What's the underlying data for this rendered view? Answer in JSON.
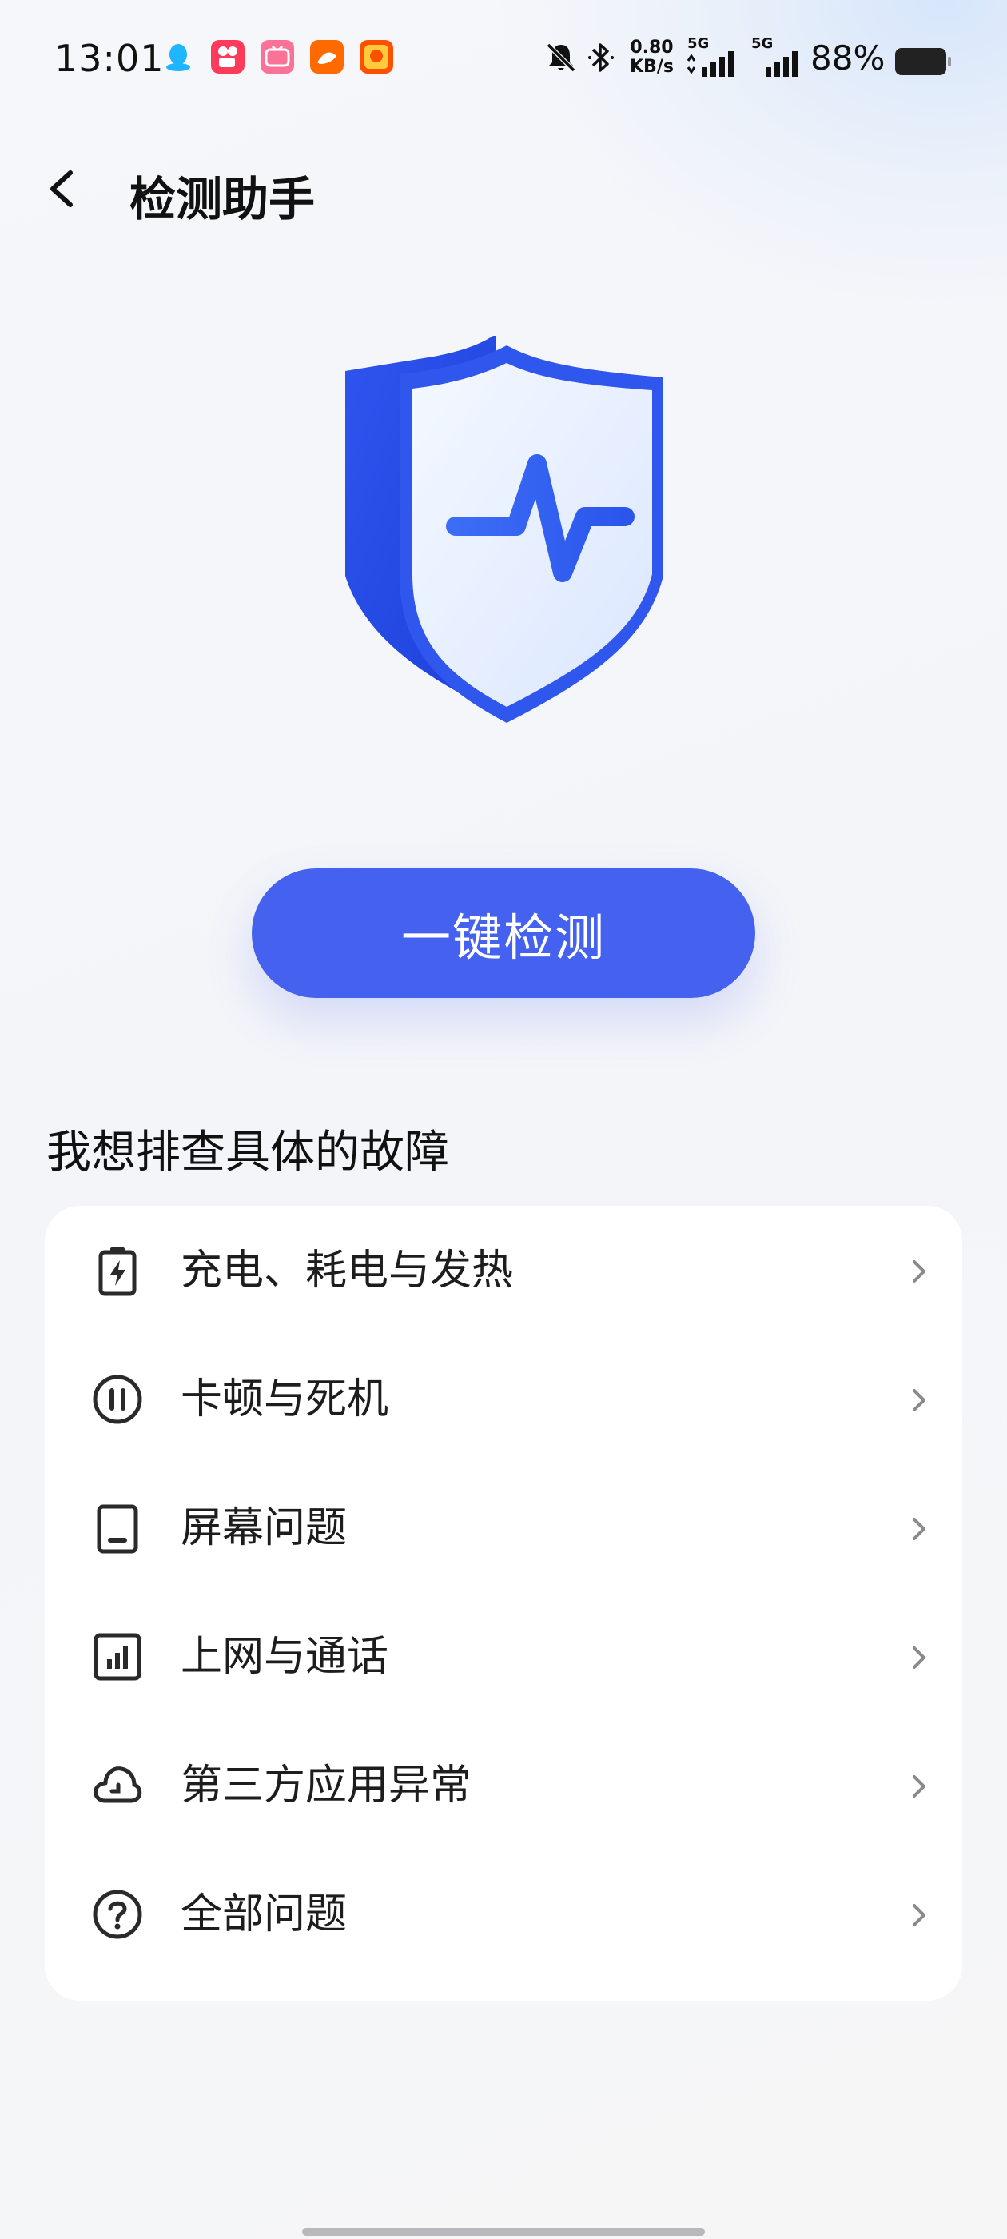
{
  "status_bar": {
    "time": "13:01",
    "net_speed_value": "0.80",
    "net_speed_unit": "KB/s",
    "signal1_label": "5G",
    "signal2_label": "5G",
    "battery": "88%"
  },
  "header": {
    "title": "检测助手",
    "back_icon": "chevron-left-icon"
  },
  "main": {
    "detect_button_label": "一键检测",
    "section_title": "我想排查具体的故障"
  },
  "issues": [
    {
      "label": "充电、耗电与发热",
      "icon": "battery-charge-icon"
    },
    {
      "label": "卡顿与死机",
      "icon": "pause-circle-icon"
    },
    {
      "label": "屏幕问题",
      "icon": "screen-icon"
    },
    {
      "label": "上网与通话",
      "icon": "signal-box-icon"
    },
    {
      "label": "第三方应用异常",
      "icon": "cloud-icon"
    },
    {
      "label": "全部问题",
      "icon": "question-circle-icon"
    }
  ],
  "colors": {
    "accent": "#4461ef",
    "card_bg": "#ffffff",
    "page_bg": "#f5f6f9"
  }
}
